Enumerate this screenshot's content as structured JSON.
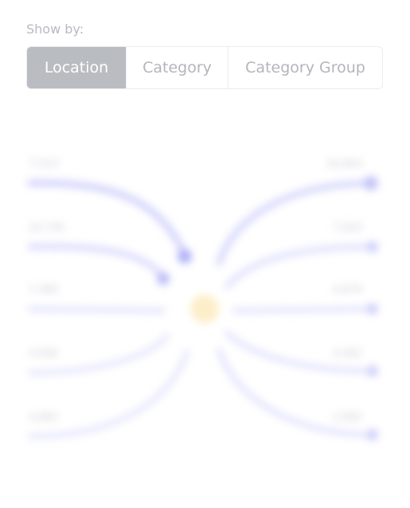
{
  "show_by": {
    "label": "Show by:",
    "options": [
      "Location",
      "Category",
      "Category Group"
    ],
    "selected": "Location"
  },
  "flow_diagram": {
    "left_labels": [
      "7,523",
      "10,745",
      "7,480",
      "4,946",
      "4,865"
    ],
    "right_labels": [
      "16,843",
      "7,943",
      "4,879",
      "4,462",
      "2,892"
    ],
    "colors": {
      "flow": "#cfd0fb",
      "arrow": "#aeb0f6",
      "center": "#fdeec9"
    }
  }
}
